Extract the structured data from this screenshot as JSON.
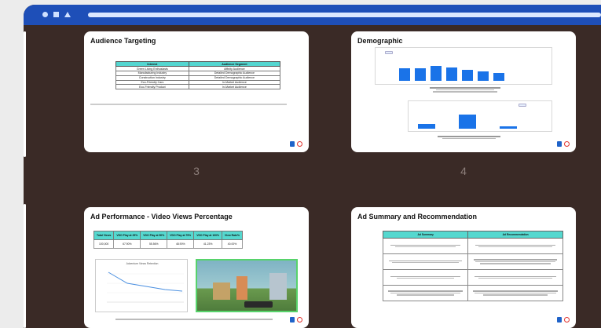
{
  "slides": {
    "s1": {
      "title": "Audience Targeting",
      "columns": [
        "Interest",
        "Audience Segment"
      ],
      "rows": [
        [
          "Green Living Enthusiasts",
          "Affinity Audience"
        ],
        [
          "Manufacturing Industry",
          "Detailed Demographic Audience"
        ],
        [
          "Construction Industry",
          "Detailed Demographic Audience"
        ],
        [
          "Eco-Friendly Cars",
          "In-Market Audience"
        ],
        [
          "Eco-Friendly Product",
          "In-Market Audience"
        ]
      ]
    },
    "s2": {
      "title": "Demographic",
      "number": "4"
    },
    "s1_number": "3",
    "s3": {
      "title": "Ad Performance - Video Views Percentage",
      "columns": [
        "Total Views",
        "VDO Play at 25%",
        "VDO Play at 50%",
        "VDO Play at 75%",
        "VDO Play at 100%",
        "View Rate%"
      ],
      "values": [
        "100,000",
        "67.90%",
        "55.56%",
        "48.90%",
        "41.23%",
        "40.00%"
      ],
      "chart_title": "Adventure Views Retention"
    },
    "s4": {
      "title": "Ad Summary and Recommendation",
      "columns": [
        "Ad Summary",
        "Ad Recommendation"
      ]
    }
  },
  "colors": {
    "window": "#3a2a26",
    "titlebar": "#1e4fb8",
    "table_header": "#55d8cf",
    "bar": "#1a73e8",
    "video_border": "#57d36b"
  }
}
